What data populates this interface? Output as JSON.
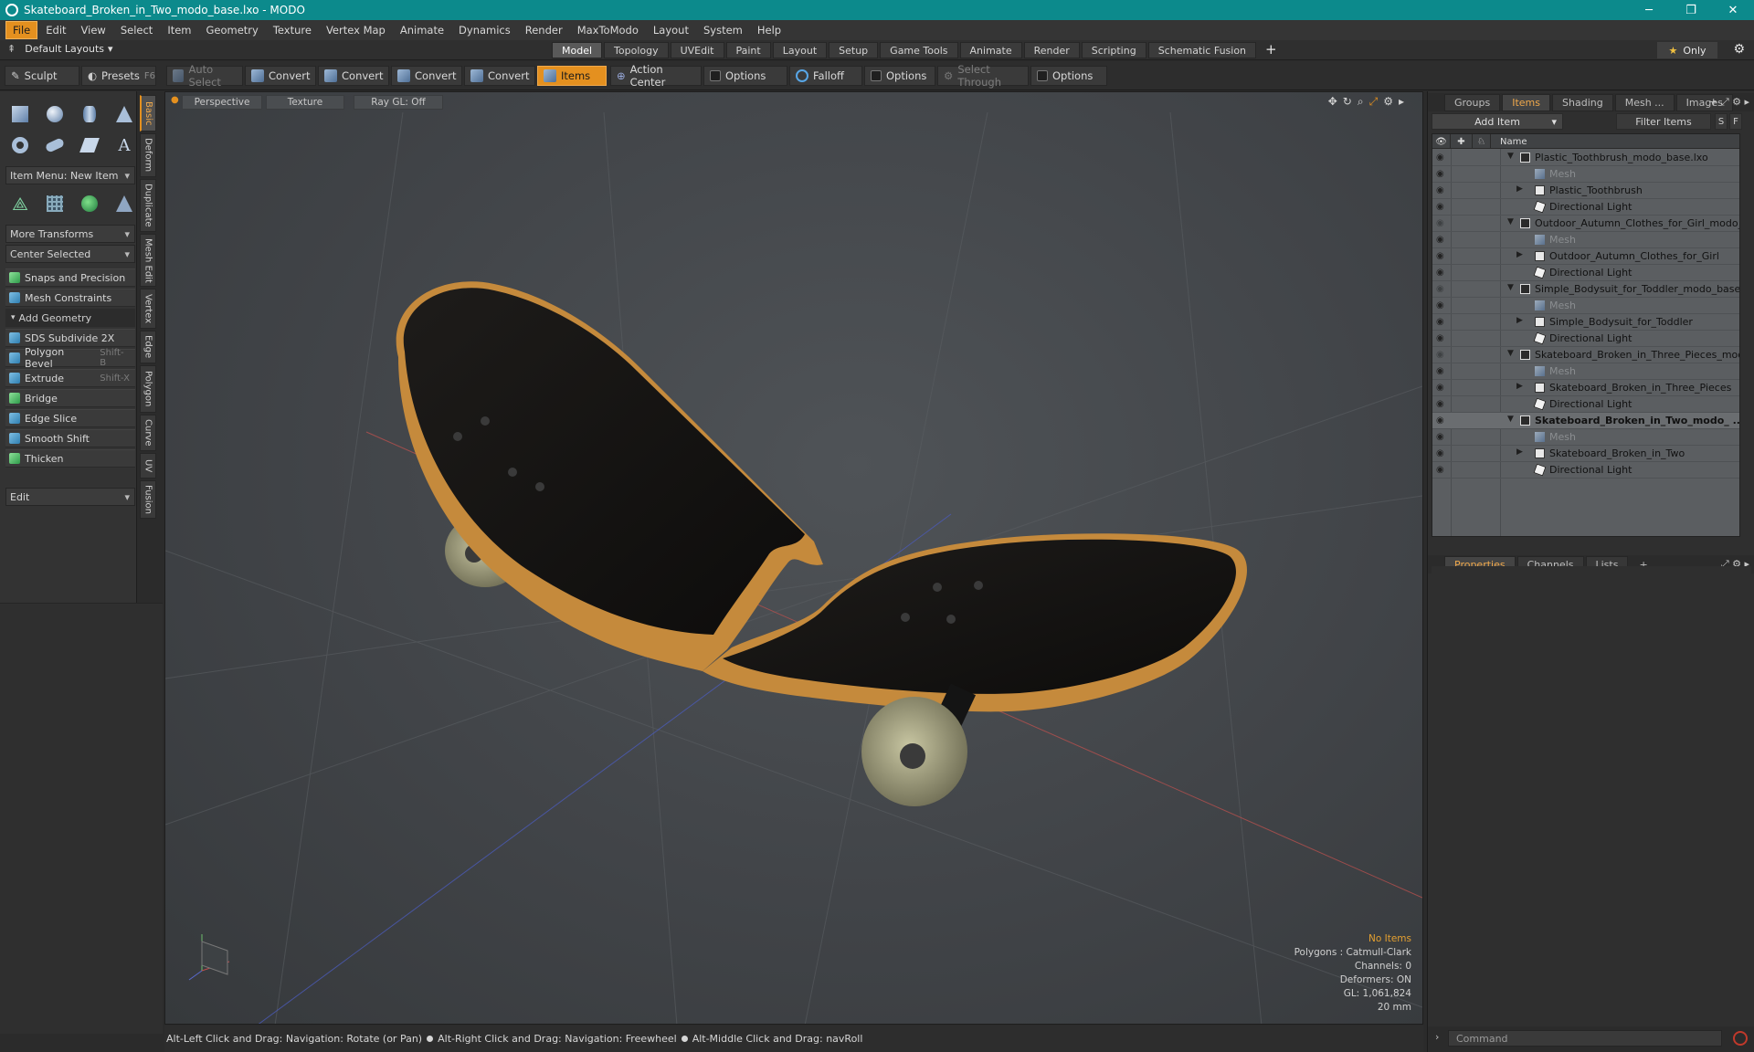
{
  "window": {
    "title": "Skateboard_Broken_in_Two_modo_base.lxo - MODO",
    "controls": [
      "─",
      "❐",
      "✕"
    ]
  },
  "menubar": [
    "File",
    "Edit",
    "View",
    "Select",
    "Item",
    "Geometry",
    "Texture",
    "Vertex Map",
    "Animate",
    "Dynamics",
    "Render",
    "MaxToModo",
    "Layout",
    "System",
    "Help"
  ],
  "layoutbar": {
    "layouts_label": "Default Layouts",
    "tabs": [
      "Model",
      "Topology",
      "UVEdit",
      "Paint",
      "Layout",
      "Setup",
      "Game Tools",
      "Animate",
      "Render",
      "Scripting",
      "Schematic Fusion"
    ],
    "active_tab": "Model",
    "only_label": "Only"
  },
  "toolbar": {
    "sculpt": "Sculpt",
    "presets": "Presets",
    "presets_key": "F6",
    "auto_select": "Auto Select",
    "convert1": "Convert",
    "convert2": "Convert",
    "convert3": "Convert",
    "convert4": "Convert",
    "items": "Items",
    "action_center": "Action Center",
    "options1": "Options",
    "falloff": "Falloff",
    "options2": "Options",
    "select_through": "Select Through",
    "options3": "Options"
  },
  "leftpanel": {
    "item_menu": "Item Menu: New Item",
    "more_transforms": "More Transforms",
    "center_selected": "Center Selected",
    "snaps": "Snaps and Precision",
    "mesh_constraints": "Mesh Constraints",
    "add_geometry": "Add Geometry",
    "tools": [
      {
        "label": "SDS Subdivide 2X",
        "key": ""
      },
      {
        "label": "Polygon Bevel",
        "key": "Shift-B"
      },
      {
        "label": "Extrude",
        "key": "Shift-X"
      },
      {
        "label": "Bridge",
        "key": ""
      },
      {
        "label": "Edge Slice",
        "key": ""
      },
      {
        "label": "Smooth Shift",
        "key": ""
      },
      {
        "label": "Thicken",
        "key": ""
      }
    ],
    "edit": "Edit"
  },
  "vtabs": [
    "Basic",
    "Deform",
    "Duplicate",
    "Mesh Edit",
    "Vertex",
    "Edge",
    "Polygon",
    "Curve",
    "UV",
    "Fusion"
  ],
  "viewport": {
    "perspective": "Perspective",
    "texture": "Texture",
    "raygl": "Ray GL: Off",
    "info": {
      "no_items": "No Items",
      "polygons": "Polygons : Catmull-Clark",
      "channels": "Channels: 0",
      "deformers": "Deformers: ON",
      "gl": "GL: 1,061,824",
      "scale": "20 mm"
    }
  },
  "statusbar": {
    "hint1": "Alt-Left Click and Drag: Navigation: Rotate (or Pan)",
    "hint2": "Alt-Right Click and Drag: Navigation: Freewheel",
    "hint3": "Alt-Middle Click and Drag: navRoll"
  },
  "rightpanel": {
    "top_tabs": [
      "Groups",
      "Items",
      "Shading",
      "Mesh ...",
      "Images"
    ],
    "active_top": "Items",
    "add_item": "Add Item",
    "filter_items": "Filter Items",
    "s_label": "S",
    "f_label": "F",
    "name_header": "Name",
    "rows": [
      {
        "label": "Plastic_Toothbrush_modo_base.lxo",
        "level": 0,
        "type": "scene",
        "style": "normal",
        "eye": "on"
      },
      {
        "label": "Mesh",
        "level": 1,
        "type": "mesh",
        "style": "dim",
        "eye": "on"
      },
      {
        "label": "Plastic_Toothbrush",
        "level": 1,
        "type": "group",
        "style": "normal",
        "eye": "on"
      },
      {
        "label": "Directional Light",
        "level": 1,
        "type": "light",
        "style": "normal",
        "eye": "on"
      },
      {
        "label": "Outdoor_Autumn_Clothes_for_Girl_modo_ ...",
        "level": 0,
        "type": "scene",
        "style": "normal",
        "eye": "off"
      },
      {
        "label": "Mesh",
        "level": 1,
        "type": "mesh",
        "style": "dim",
        "eye": "on"
      },
      {
        "label": "Outdoor_Autumn_Clothes_for_Girl",
        "level": 1,
        "type": "group",
        "style": "normal",
        "eye": "on"
      },
      {
        "label": "Directional Light",
        "level": 1,
        "type": "light",
        "style": "normal",
        "eye": "on"
      },
      {
        "label": "Simple_Bodysuit_for_Toddler_modo_base.lxo",
        "level": 0,
        "type": "scene",
        "style": "normal",
        "eye": "off"
      },
      {
        "label": "Mesh",
        "level": 1,
        "type": "mesh",
        "style": "dim",
        "eye": "on"
      },
      {
        "label": "Simple_Bodysuit_for_Toddler",
        "level": 1,
        "type": "group",
        "style": "normal",
        "eye": "on"
      },
      {
        "label": "Directional Light",
        "level": 1,
        "type": "light",
        "style": "normal",
        "eye": "on"
      },
      {
        "label": "Skateboard_Broken_in_Three_Pieces_mod ...",
        "level": 0,
        "type": "scene",
        "style": "normal",
        "eye": "off"
      },
      {
        "label": "Mesh",
        "level": 1,
        "type": "mesh",
        "style": "dim",
        "eye": "on"
      },
      {
        "label": "Skateboard_Broken_in_Three_Pieces",
        "level": 1,
        "type": "group",
        "style": "normal",
        "eye": "on"
      },
      {
        "label": "Directional Light",
        "level": 1,
        "type": "light",
        "style": "normal",
        "eye": "on"
      },
      {
        "label": "Skateboard_Broken_in_Two_modo_ ...",
        "level": 0,
        "type": "scene",
        "style": "bold",
        "eye": "on"
      },
      {
        "label": "Mesh",
        "level": 1,
        "type": "mesh",
        "style": "dim",
        "eye": "on"
      },
      {
        "label": "Skateboard_Broken_in_Two",
        "level": 1,
        "type": "group",
        "style": "normal",
        "eye": "on"
      },
      {
        "label": "Directional Light",
        "level": 1,
        "type": "light",
        "style": "normal",
        "eye": "on"
      }
    ],
    "prop_tabs": [
      "Properties",
      "Channels",
      "Lists"
    ],
    "active_prop": "Properties",
    "command_placeholder": "Command"
  },
  "colors": {
    "accent": "#e4901f",
    "titlebar": "#0c8a8c"
  }
}
